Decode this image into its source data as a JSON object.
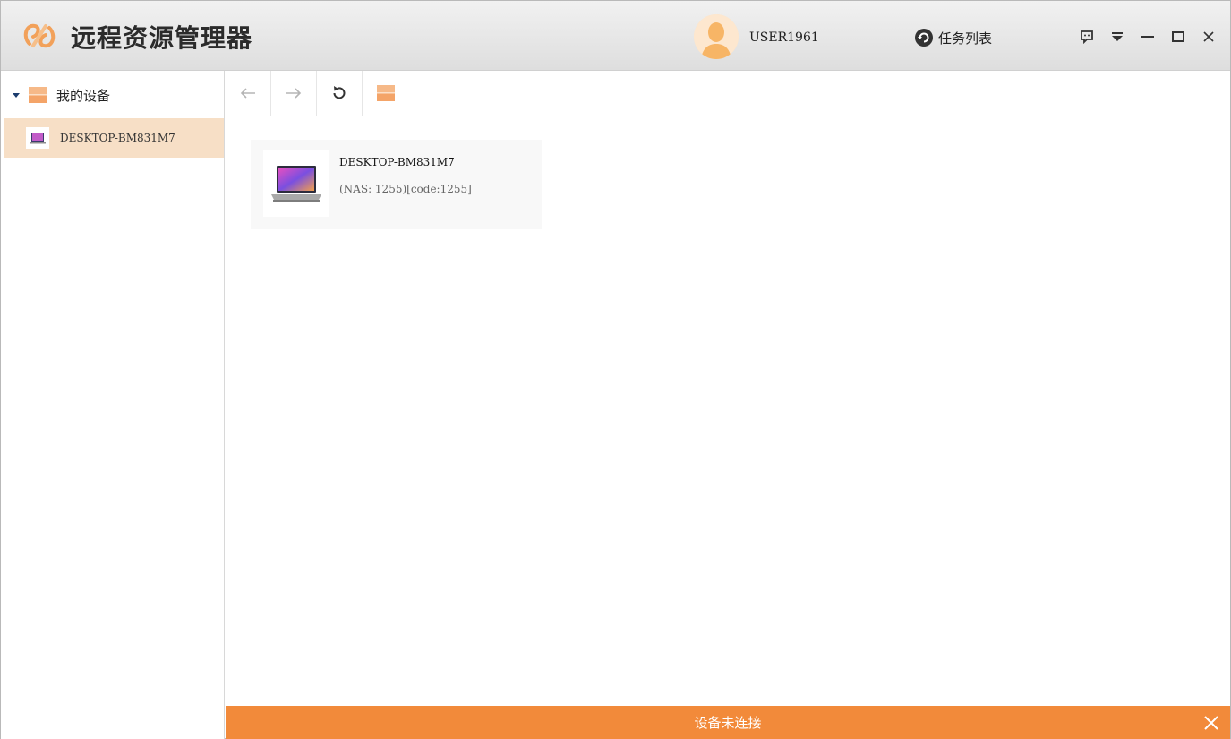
{
  "header": {
    "app_title": "远程资源管理器",
    "username": "USER1961",
    "task_list_label": "任务列表"
  },
  "icons": {
    "logo": "remote-explorer-logo-icon",
    "avatar": "user-avatar-icon",
    "task_list": "refresh-circle-icon",
    "feedback": "message-icon",
    "menu": "dropdown-menu-icon",
    "minimize": "minimize-icon",
    "maximize": "maximize-icon",
    "close": "close-icon",
    "back": "arrow-left-icon",
    "forward": "arrow-right-icon",
    "refresh": "refresh-icon",
    "folder": "folder-icon",
    "laptop": "laptop-icon"
  },
  "sidebar": {
    "root_label": "我的设备",
    "items": [
      {
        "label": "DESKTOP-BM831M7",
        "selected": true
      }
    ]
  },
  "main": {
    "devices": [
      {
        "name": "DESKTOP-BM831M7",
        "info": "(NAS: 1255)[code:1255]"
      }
    ]
  },
  "status": {
    "text": "设备未连接"
  },
  "colors": {
    "accent": "#f28a3a",
    "selected_bg": "#f7dfc6",
    "folder": "#f4a468"
  }
}
